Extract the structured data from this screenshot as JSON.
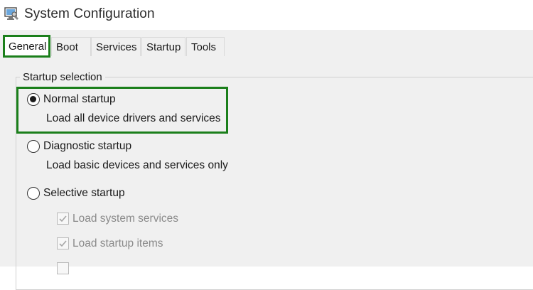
{
  "window": {
    "title": "System Configuration",
    "icon": "system-config-icon"
  },
  "tabs": [
    {
      "label": "General",
      "active": true
    },
    {
      "label": "Boot",
      "active": false
    },
    {
      "label": "Services",
      "active": false
    },
    {
      "label": "Startup",
      "active": false
    },
    {
      "label": "Tools",
      "active": false
    }
  ],
  "startup_selection": {
    "label": "Startup selection",
    "options": [
      {
        "label": "Normal startup",
        "description": "Load all device drivers and services",
        "selected": true
      },
      {
        "label": "Diagnostic startup",
        "description": "Load basic devices and services only",
        "selected": false
      },
      {
        "label": "Selective startup",
        "selected": false
      }
    ],
    "selective_items": [
      {
        "label": "Load system services",
        "checked": true,
        "enabled": false
      },
      {
        "label": "Load startup items",
        "checked": true,
        "enabled": false
      }
    ]
  },
  "colors": {
    "highlight": "#1b7f1b",
    "tabstrip": "#f0f0f0"
  }
}
